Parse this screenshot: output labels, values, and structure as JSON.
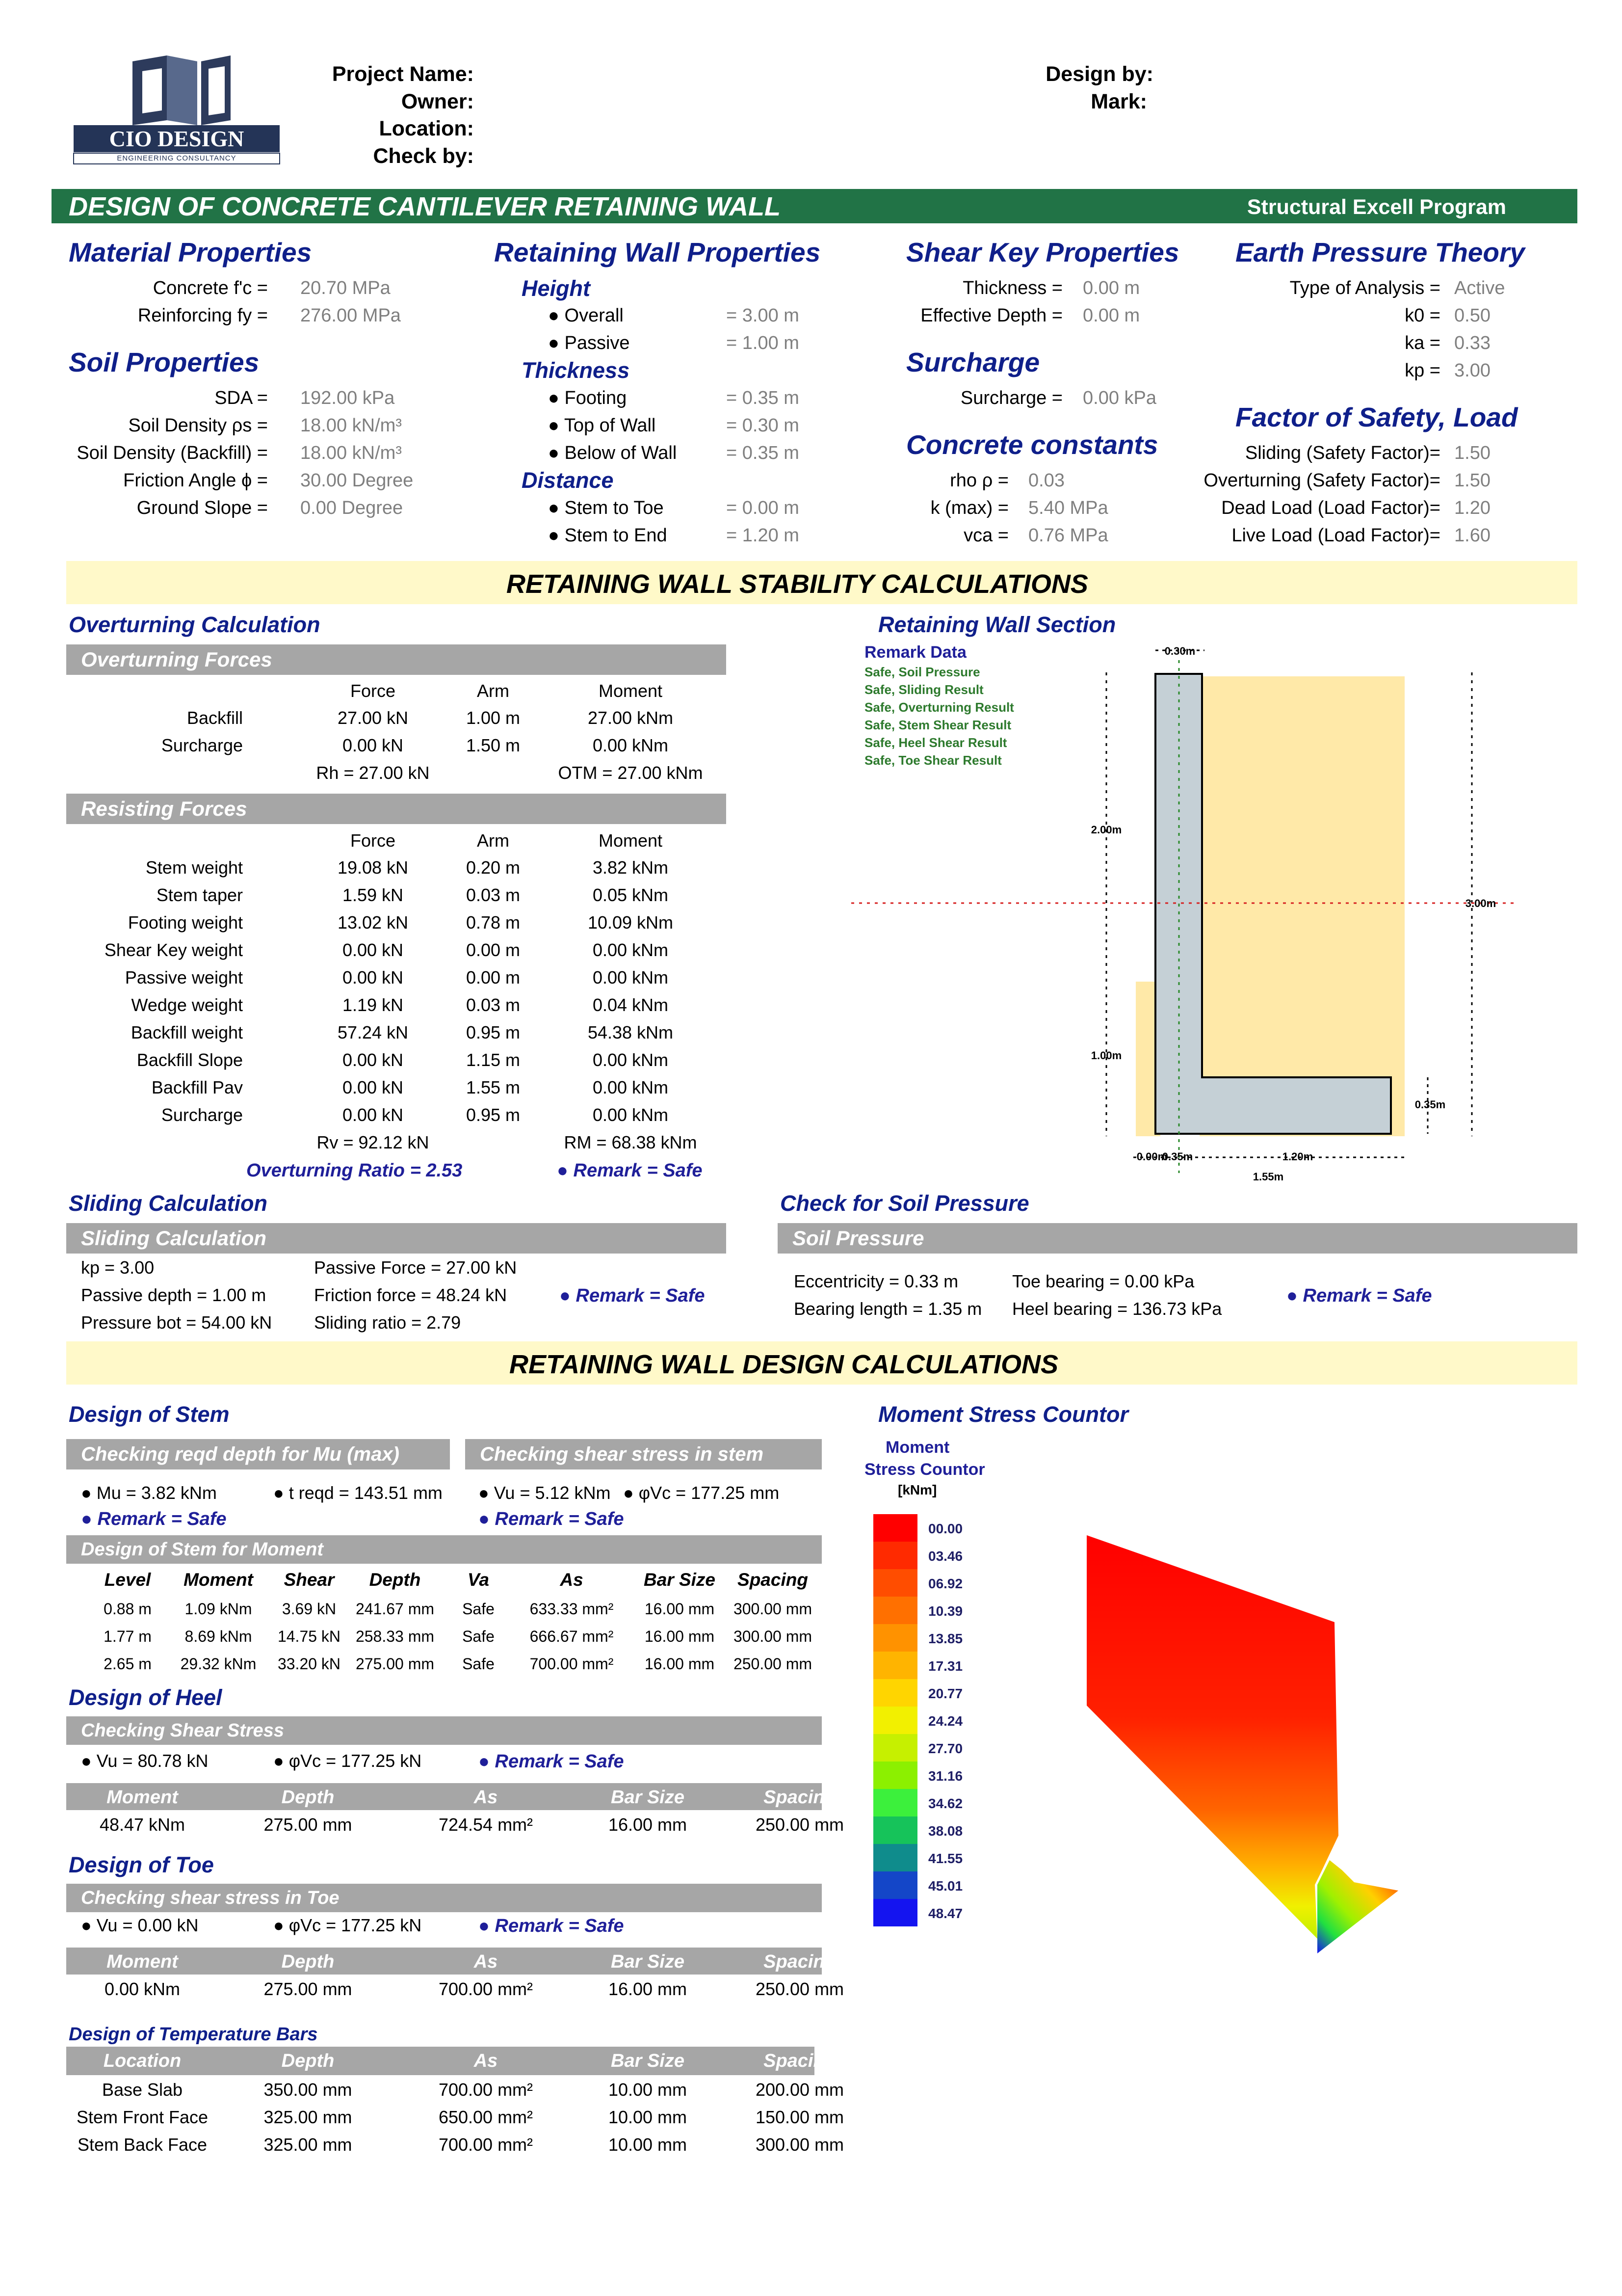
{
  "logo": {
    "name": "CIO DESIGN",
    "tagline": "ENGINEERING CONSULTANCY"
  },
  "header": {
    "left_labels": [
      "Project Name:",
      "Owner:",
      "Location:",
      "Check by:"
    ],
    "right_labels": [
      "Design by:",
      "Mark:"
    ]
  },
  "titlebar": {
    "title": "DESIGN OF CONCRETE CANTILEVER RETAINING WALL",
    "program": "Structural Excell Program",
    "color": "#217346"
  },
  "material": {
    "title": "Material Properties",
    "rows": [
      {
        "label": "Concrete f'c =",
        "value": "20.70 MPa"
      },
      {
        "label": "Reinforcing fy =",
        "value": "276.00 MPa"
      }
    ]
  },
  "soil": {
    "title": "Soil Properties",
    "rows": [
      {
        "label": "SDA =",
        "value": "192.00 kPa"
      },
      {
        "label": "Soil Density ρs =",
        "value": "18.00 kN/m³"
      },
      {
        "label": "Soil Density (Backfill) =",
        "value": "18.00 kN/m³"
      },
      {
        "label": "Friction Angle ϕ =",
        "value": "30.00 Degree"
      },
      {
        "label": "Ground Slope =",
        "value": "0.00 Degree"
      }
    ]
  },
  "wall": {
    "title": "Retaining Wall Properties",
    "height_title": "Height",
    "height": [
      {
        "label": "● Overall",
        "value": "= 3.00 m"
      },
      {
        "label": "● Passive",
        "value": "= 1.00 m"
      }
    ],
    "thickness_title": "Thickness",
    "thickness": [
      {
        "label": "● Footing",
        "value": "= 0.35 m"
      },
      {
        "label": "● Top of Wall",
        "value": "= 0.30 m"
      },
      {
        "label": "● Below of Wall",
        "value": "= 0.35 m"
      }
    ],
    "distance_title": "Distance",
    "distance": [
      {
        "label": "● Stem to Toe",
        "value": "= 0.00 m"
      },
      {
        "label": "● Stem to End",
        "value": "= 1.20 m"
      }
    ]
  },
  "shearkey": {
    "title": "Shear Key Properties",
    "rows": [
      {
        "label": "Thickness =",
        "value": "0.00 m"
      },
      {
        "label": "Effective Depth =",
        "value": "0.00 m"
      }
    ]
  },
  "surcharge": {
    "title": "Surcharge",
    "label": "Surcharge =",
    "value": "0.00 kPa"
  },
  "concrete": {
    "title": "Concrete constants",
    "rows": [
      {
        "label": "rho ρ =",
        "value": "0.03"
      },
      {
        "label": "k (max) =",
        "value": "5.40 MPa"
      },
      {
        "label": "vca =",
        "value": "0.76 MPa"
      }
    ]
  },
  "earth": {
    "title": "Earth Pressure Theory",
    "rows": [
      {
        "label": "Type of Analysis =",
        "value": "Active"
      },
      {
        "label": "k0 =",
        "value": "0.50"
      },
      {
        "label": "ka =",
        "value": "0.33"
      },
      {
        "label": "kp =",
        "value": "3.00"
      }
    ]
  },
  "fos": {
    "title": "Factor of Safety, Load",
    "rows": [
      {
        "label": "Sliding (Safety Factor)=",
        "value": "1.50"
      },
      {
        "label": "Overturning (Safety Factor)=",
        "value": "1.50"
      },
      {
        "label": "Dead Load (Load Factor)=",
        "value": "1.20"
      },
      {
        "label": "Live Load (Load Factor)=",
        "value": "1.60"
      }
    ]
  },
  "stability_title": "RETAINING WALL STABILITY CALCULATIONS",
  "overturning": {
    "title": "Overturning Calculation",
    "forces_title": "Overturning Forces",
    "headers": [
      "Force",
      "Arm",
      "Moment"
    ],
    "forces": [
      {
        "label": "Backfill",
        "force": "27.00 kN",
        "arm": "1.00 m",
        "moment": "27.00 kNm"
      },
      {
        "label": "Surcharge",
        "force": "0.00 kN",
        "arm": "1.50 m",
        "moment": "0.00 kNm"
      }
    ],
    "rh": "Rh = 27.00 kN",
    "otm": "OTM = 27.00 kNm",
    "resisting_title": "Resisting Forces",
    "resisting": [
      {
        "label": "Stem weight",
        "force": "19.08 kN",
        "arm": "0.20 m",
        "moment": "3.82 kNm"
      },
      {
        "label": "Stem taper",
        "force": "1.59 kN",
        "arm": "0.03 m",
        "moment": "0.05 kNm"
      },
      {
        "label": "Footing weight",
        "force": "13.02 kN",
        "arm": "0.78 m",
        "moment": "10.09 kNm"
      },
      {
        "label": "Shear Key weight",
        "force": "0.00 kN",
        "arm": "0.00 m",
        "moment": "0.00 kNm"
      },
      {
        "label": "Passive weight",
        "force": "0.00 kN",
        "arm": "0.00 m",
        "moment": "0.00 kNm"
      },
      {
        "label": "Wedge weight",
        "force": "1.19 kN",
        "arm": "0.03 m",
        "moment": "0.04 kNm"
      },
      {
        "label": "Backfill weight",
        "force": "57.24 kN",
        "arm": "0.95 m",
        "moment": "54.38 kNm"
      },
      {
        "label": "Backfill Slope",
        "force": "0.00 kN",
        "arm": "1.15 m",
        "moment": "0.00 kNm"
      },
      {
        "label": "Backfill Pav",
        "force": "0.00 kN",
        "arm": "1.55 m",
        "moment": "0.00 kNm"
      },
      {
        "label": "Surcharge",
        "force": "0.00 kN",
        "arm": "0.95 m",
        "moment": "0.00 kNm"
      }
    ],
    "rv": "Rv = 92.12 kN",
    "rm": "RM = 68.38 kNm",
    "ratio": "Overturning Ratio = 2.53",
    "remark": "● Remark = Safe"
  },
  "section": {
    "title": "Retaining Wall Section",
    "remark_title": "Remark Data",
    "remarks": [
      "Safe, Soil Pressure",
      "Safe, Sliding Result",
      "Safe, Overturning Result",
      "Safe, Stem Shear Result",
      "Safe, Heel  Shear Result",
      "Safe, Toe   Shear Result"
    ],
    "dims": {
      "top": "0.30m",
      "stem": "2.00m",
      "overall": "3.00m",
      "passive": "1.00m",
      "footing": "0.35m",
      "toe": "0.00m",
      "stemb": "0.35m",
      "heel": "1.20m",
      "total": "1.55m"
    },
    "colors": {
      "soil": "#ffe9a8",
      "concrete": "#c5d0d6"
    }
  },
  "sliding": {
    "title": "Sliding Calculation",
    "bar": "Sliding Calculation",
    "col1": [
      "kp  = 3.00",
      "Passive depth = 1.00 m",
      "Pressure bot = 54.00 kN"
    ],
    "col2": [
      "Passive Force = 27.00 kN",
      "Friction force = 48.24 kN",
      "Sliding ratio = 2.79"
    ],
    "remark": "● Remark = Safe"
  },
  "soilpressure": {
    "title": "Check for Soil Pressure",
    "bar": "Soil Pressure",
    "col1": [
      "Eccentricity = 0.33 m",
      "Bearing length = 1.35 m"
    ],
    "col2": [
      "Toe bearing = 0.00 kPa",
      "Heel bearing = 136.73 kPa"
    ],
    "remark": "● Remark = Safe"
  },
  "design_title": "RETAINING WALL DESIGN CALCULATIONS",
  "stem": {
    "title": "Design of Stem",
    "bar1": "Checking reqd depth for Mu (max)",
    "bar2": "Checking shear stress in stem",
    "mu": "● Mu = 3.82 kNm",
    "treqd": "● t reqd = 143.51 mm",
    "vu": "● Vu = 5.12 kNm",
    "phivc": "● φVc = 177.25 mm",
    "remark1": "● Remark = Safe",
    "remark2": "● Remark = Safe",
    "moment_bar": "Design of Stem for Moment",
    "headers": [
      "Level",
      "Moment",
      "Shear",
      "Depth",
      "Va",
      "As",
      "Bar Size",
      "Spacing"
    ],
    "rows": [
      [
        "0.88 m",
        "1.09 kNm",
        "3.69 kN",
        "241.67 mm",
        "Safe",
        "633.33 mm²",
        "16.00 mm",
        "300.00 mm"
      ],
      [
        "1.77 m",
        "8.69 kNm",
        "14.75 kN",
        "258.33 mm",
        "Safe",
        "666.67 mm²",
        "16.00 mm",
        "300.00 mm"
      ],
      [
        "2.65 m",
        "29.32 kNm",
        "33.20 kN",
        "275.00 mm",
        "Safe",
        "700.00 mm²",
        "16.00 mm",
        "250.00 mm"
      ]
    ]
  },
  "heel": {
    "title": "Design of Heel",
    "bar": "Checking Shear Stress",
    "vu": "● Vu = 80.78 kN",
    "phivc": "● φVc = 177.25 kN",
    "remark": "● Remark = Safe",
    "headers": [
      "Moment",
      "Depth",
      "As",
      "Bar Size",
      "Spacing"
    ],
    "row": [
      "48.47 kNm",
      "275.00 mm",
      "724.54 mm²",
      "16.00 mm",
      "250.00 mm"
    ]
  },
  "toe": {
    "title": "Design of Toe",
    "bar": "Checking shear stress in Toe",
    "vu": "● Vu = 0.00 kN",
    "phivc": "● φVc = 177.25 kN",
    "remark": "● Remark = Safe",
    "headers": [
      "Moment",
      "Depth",
      "As",
      "Bar Size",
      "Spacing"
    ],
    "row": [
      "0.00 kNm",
      "275.00 mm",
      "700.00 mm²",
      "16.00 mm",
      "250.00 mm"
    ]
  },
  "temp": {
    "title": "Design of Temperature Bars",
    "headers": [
      "Location",
      "Depth",
      "As",
      "Bar Size",
      "Spacing"
    ],
    "rows": [
      [
        "Base Slab",
        "350.00 mm",
        "700.00 mm²",
        "10.00 mm",
        "200.00 mm"
      ],
      [
        "Stem Front Face",
        "325.00 mm",
        "650.00 mm²",
        "10.00 mm",
        "150.00 mm"
      ],
      [
        "Stem Back Face",
        "325.00 mm",
        "700.00 mm²",
        "10.00 mm",
        "300.00 mm"
      ]
    ]
  },
  "contour": {
    "title": "Moment Stress Countor",
    "legend_title1": "Moment",
    "legend_title2": "Stress Countor",
    "unit": "[kNm]",
    "levels": [
      "00.00",
      "03.46",
      "06.92",
      "10.39",
      "13.85",
      "17.31",
      "20.77",
      "24.24",
      "27.70",
      "31.16",
      "34.62",
      "38.08",
      "41.55",
      "45.01",
      "48.47"
    ],
    "colors": [
      "#ff0000",
      "#ff2a00",
      "#ff4d00",
      "#ff7000",
      "#ff9200",
      "#ffb400",
      "#ffd500",
      "#f2f000",
      "#c6f000",
      "#8cf000",
      "#3cf03c",
      "#16c35a",
      "#0f8c8c",
      "#1446c8",
      "#1414f0"
    ]
  }
}
